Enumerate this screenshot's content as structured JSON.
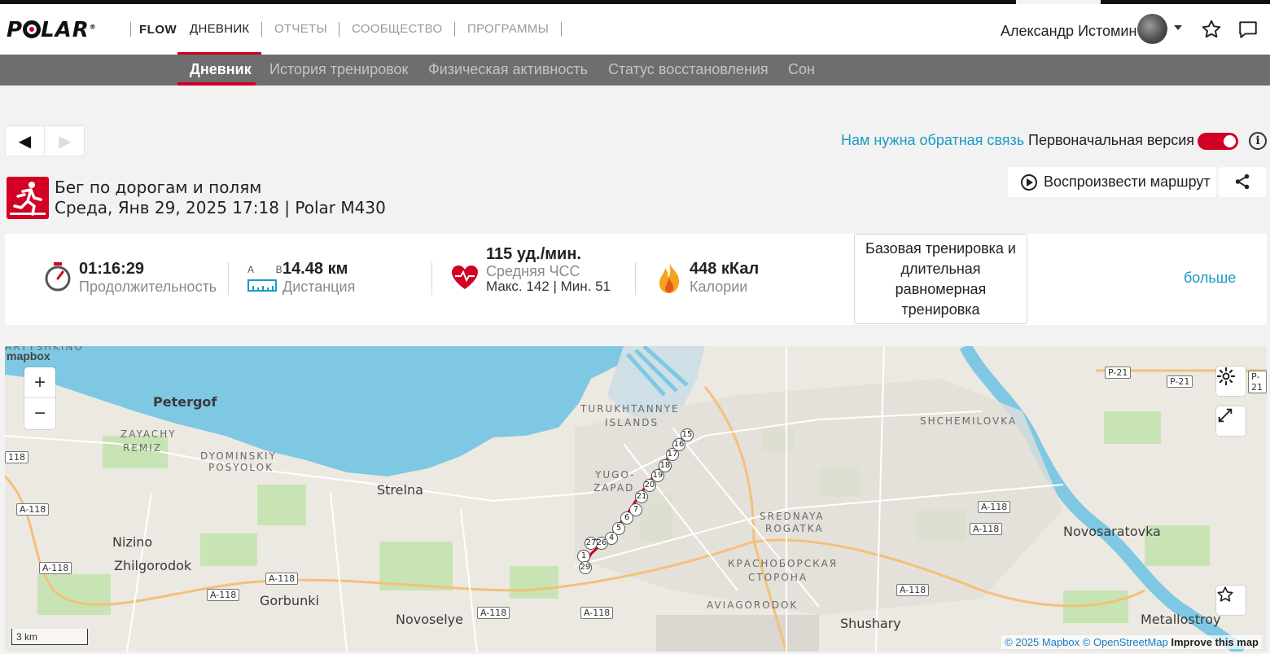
{
  "header": {
    "logo_text": "POLAR",
    "brand_sub": "FLOW",
    "nav": [
      "ДНЕВНИК",
      "ОТЧЕТЫ",
      "СООБЩЕСТВО",
      "ПРОГРАММЫ"
    ],
    "active_nav": "ДНЕВНИК",
    "user_name": "Александр Истомин"
  },
  "subnav": {
    "items": [
      "Дневник",
      "История тренировок",
      "Физическая активность",
      "Статус восстановления",
      "Сон"
    ],
    "active": "Дневник"
  },
  "toolbar": {
    "prev_glyph": "◀",
    "next_glyph": "▶",
    "feedback_link": "Нам нужна обратная связь",
    "classic_label": "Первоначальная версия",
    "classic_toggle_on": true,
    "info_glyph": "i"
  },
  "session": {
    "sport": "Бег по дорогам и полям",
    "datetime_device": "Среда, Янв 29, 2025 17:18 | Polar M430",
    "replay_button": "Воспроизвести маршрут"
  },
  "summary": {
    "duration_value": "01:16:29",
    "duration_label": "Продолжительность",
    "distance_ab": "A B",
    "distance_value": "14.48 км",
    "distance_label": "Дистанция",
    "hr_value": "115 уд./мин.",
    "hr_label": "Средняя ЧСС",
    "hr_minmax": "Макс. 142  |  Мин. 51",
    "calories_value": "448 кКал",
    "calories_label": "Калории",
    "training_benefit": "Базовая тренировка и длительная равномерная тренировка",
    "more_link": "больше"
  },
  "map": {
    "mapbox_logo": "mapbox",
    "zoom_in": "+",
    "zoom_out": "−",
    "scale_label": "3 km",
    "attribution_mapbox": "© 2025 Mapbox",
    "attribution_osm": "© OpenStreetMap",
    "attribution_improve": "Improve this map",
    "places": {
      "petergof": "Petergof",
      "zayachy": "ZAYACHY",
      "remiz": "REMIZ",
      "dyominskiy": "DYOMINSKIY",
      "posyolok": "POSYOLOK",
      "strelna": "Strelna",
      "nizino": "Nizino",
      "zhilgorodok": "Zhilgorodok",
      "gorbunki": "Gorbunki",
      "novoselye": "Novoselye",
      "turukhtannye": "TURUKHTANNYE",
      "islands": "ISLANDS",
      "yugo": "YUGO-",
      "zapad": "ZAPAD",
      "srednaya": "SREDNAYA",
      "rogatka": "ROGATKA",
      "krasnoborskaya": "КРАСНОБОРСКАЯ",
      "storona": "СТОРОНА",
      "aviagorodok": "AVIAGORODOK",
      "shushary": "Shushary",
      "shchemilovka": "SHCHEMILOVKA",
      "novosaratovka": "Novosaratovka",
      "metallostroy": "Metallostroy",
      "artyshkino": "ARTYSHKINO"
    },
    "roads": {
      "a118": "A-118",
      "r21": "P-21",
      "e118": "118"
    },
    "lap_markers": [
      "15",
      "16",
      "17",
      "18",
      "19",
      "20",
      "21",
      "7",
      "6",
      "5",
      "4",
      "26",
      "27",
      "1",
      "29"
    ]
  },
  "colors": {
    "accent": "#d10024",
    "link": "#1a9bc7",
    "subnav_bg": "#6e6e6e",
    "water": "#7ec8e3",
    "park": "#c9e4b4"
  }
}
